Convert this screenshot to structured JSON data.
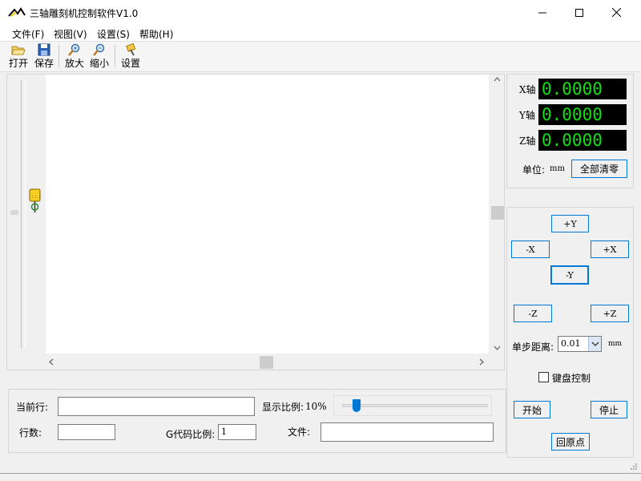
{
  "window": {
    "title": "三轴雕刻机控制软件V1.0"
  },
  "menu": [
    "文件(F)",
    "视图(V)",
    "设置(S)",
    "帮助(H)"
  ],
  "toolbar": {
    "open": "打开",
    "save": "保存",
    "zoom_in": "放大",
    "zoom_out": "缩小",
    "settings": "设置"
  },
  "coords": {
    "x_label": "X轴",
    "x_value": "0.0000",
    "y_label": "Y轴",
    "y_value": "0.0000",
    "z_label": "Z轴",
    "z_value": "0.0000",
    "unit_label": "单位:",
    "unit_value": "mm",
    "clear_all": "全部清零"
  },
  "jog": {
    "plus_y": "+Y",
    "minus_x": "-X",
    "plus_x": "+X",
    "minus_y": "-Y",
    "minus_z": "-Z",
    "plus_z": "+Z",
    "step_label": "单步距离:",
    "step_value": "0.01",
    "step_unit": "mm",
    "keyboard_label": "键盘控制",
    "keyboard_checked": false,
    "start": "开始",
    "stop": "停止",
    "home": "回原点"
  },
  "status": {
    "current_line_label": "当前行:",
    "current_line_value": "",
    "display_scale_label": "显示比例:",
    "display_scale_value": "10%",
    "display_scale_fraction": 0.1,
    "line_count_label": "行数:",
    "line_count_value": "",
    "gcode_scale_label": "G代码比例:",
    "gcode_scale_value": "1",
    "file_label": "文件:",
    "file_value": ""
  },
  "colors": {
    "lcd_bg": "#000000",
    "lcd_fg": "#13e013",
    "accent": "#0078d7"
  }
}
